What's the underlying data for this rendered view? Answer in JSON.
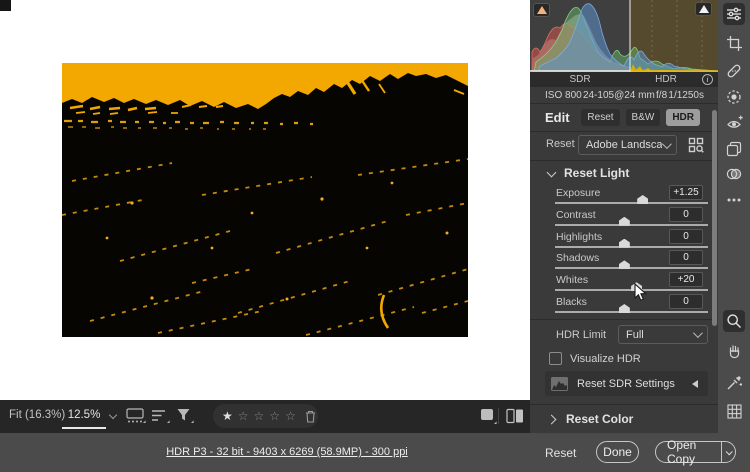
{
  "colors": {
    "sky_yellow": "#F2A800",
    "light_speck": "#D79A12",
    "hdr_base_yellow": "#E5B90A"
  },
  "histogram": {
    "sdr_label": "SDR",
    "hdr_label": "HDR",
    "info_icon": "i"
  },
  "exif": {
    "iso": "ISO 800",
    "lens": "24-105@24 mm",
    "aperture": "f/8",
    "shutter": "1/1250s"
  },
  "edit_panel": {
    "title": "Edit",
    "reset_button": "Reset",
    "bw_button": "B&W",
    "hdr_button": "HDR",
    "profile_row": {
      "reset_label": "Reset",
      "profile_value": "Adobe Landscape"
    },
    "light_section": {
      "title": "Reset Light",
      "sliders": [
        {
          "label": "Exposure",
          "value": "+1.25",
          "pos": 57
        },
        {
          "label": "Contrast",
          "value": "0",
          "pos": 45
        },
        {
          "label": "Highlights",
          "value": "0",
          "pos": 45
        },
        {
          "label": "Shadows",
          "value": "0",
          "pos": 45
        },
        {
          "label": "Whites",
          "value": "+20",
          "pos": 53
        },
        {
          "label": "Blacks",
          "value": "0",
          "pos": 45
        }
      ]
    },
    "hdr_limit": {
      "label": "HDR Limit",
      "value": "Full"
    },
    "visualize_hdr": {
      "label": "Visualize HDR",
      "checked": false
    },
    "reset_sdr_label": "Reset SDR Settings",
    "color_section_title": "Reset Color"
  },
  "tool_strip": {
    "top_tools": [
      "edit",
      "crop",
      "heal",
      "masking",
      "red-eye",
      "presets",
      "snapshots",
      "more"
    ],
    "bottom_tools": [
      "zoom",
      "hand",
      "white-balance",
      "grid"
    ],
    "active_top": "edit",
    "active_bottom": "zoom"
  },
  "view_toolbar": {
    "fit_label": "Fit (16.3%)",
    "zoom_level": "12.5%",
    "rating": 1,
    "stars_total": 5
  },
  "status_bar": {
    "file_info": "HDR P3 - 32 bit - 9403 x 6269 (58.9MP) - 300 ppi",
    "reset_label": "Reset",
    "done_label": "Done",
    "open_copy_label": "Open Copy"
  }
}
